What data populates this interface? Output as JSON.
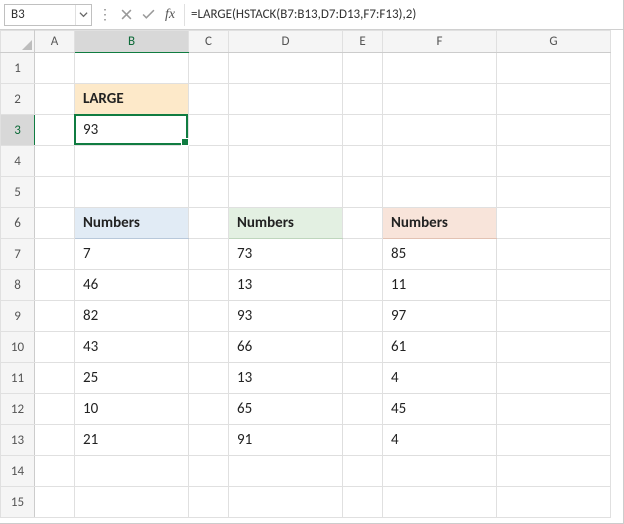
{
  "namebox": "B3",
  "formula": "=LARGE(HSTACK(B7:B13,D7:D13,F7:F13),2)",
  "columns": [
    "A",
    "B",
    "C",
    "D",
    "E",
    "F",
    "G"
  ],
  "rows": [
    "1",
    "2",
    "3",
    "4",
    "5",
    "6",
    "7",
    "8",
    "9",
    "10",
    "11",
    "12",
    "13",
    "14",
    "15"
  ],
  "active_cell": "B3",
  "title_label": "LARGE",
  "result_value": "93",
  "header_label": "Numbers",
  "table1": [
    "7",
    "46",
    "82",
    "43",
    "25",
    "10",
    "21"
  ],
  "table2": [
    "73",
    "13",
    "93",
    "66",
    "13",
    "65",
    "91"
  ],
  "table3": [
    "85",
    "11",
    "97",
    "61",
    "4",
    "45",
    "4"
  ],
  "col_widths": {
    "A": 40,
    "B": 114,
    "C": 40,
    "D": 114,
    "E": 40,
    "F": 114,
    "G": 114
  },
  "chart_data": {
    "type": "table",
    "title": "LARGE",
    "result": 93,
    "formula": "=LARGE(HSTACK(B7:B13,D7:D13,F7:F13),2)",
    "series": [
      {
        "name": "Numbers",
        "values": [
          7,
          46,
          82,
          43,
          25,
          10,
          21
        ]
      },
      {
        "name": "Numbers",
        "values": [
          73,
          13,
          93,
          66,
          13,
          65,
          91
        ]
      },
      {
        "name": "Numbers",
        "values": [
          85,
          11,
          97,
          61,
          4,
          45,
          4
        ]
      }
    ]
  }
}
